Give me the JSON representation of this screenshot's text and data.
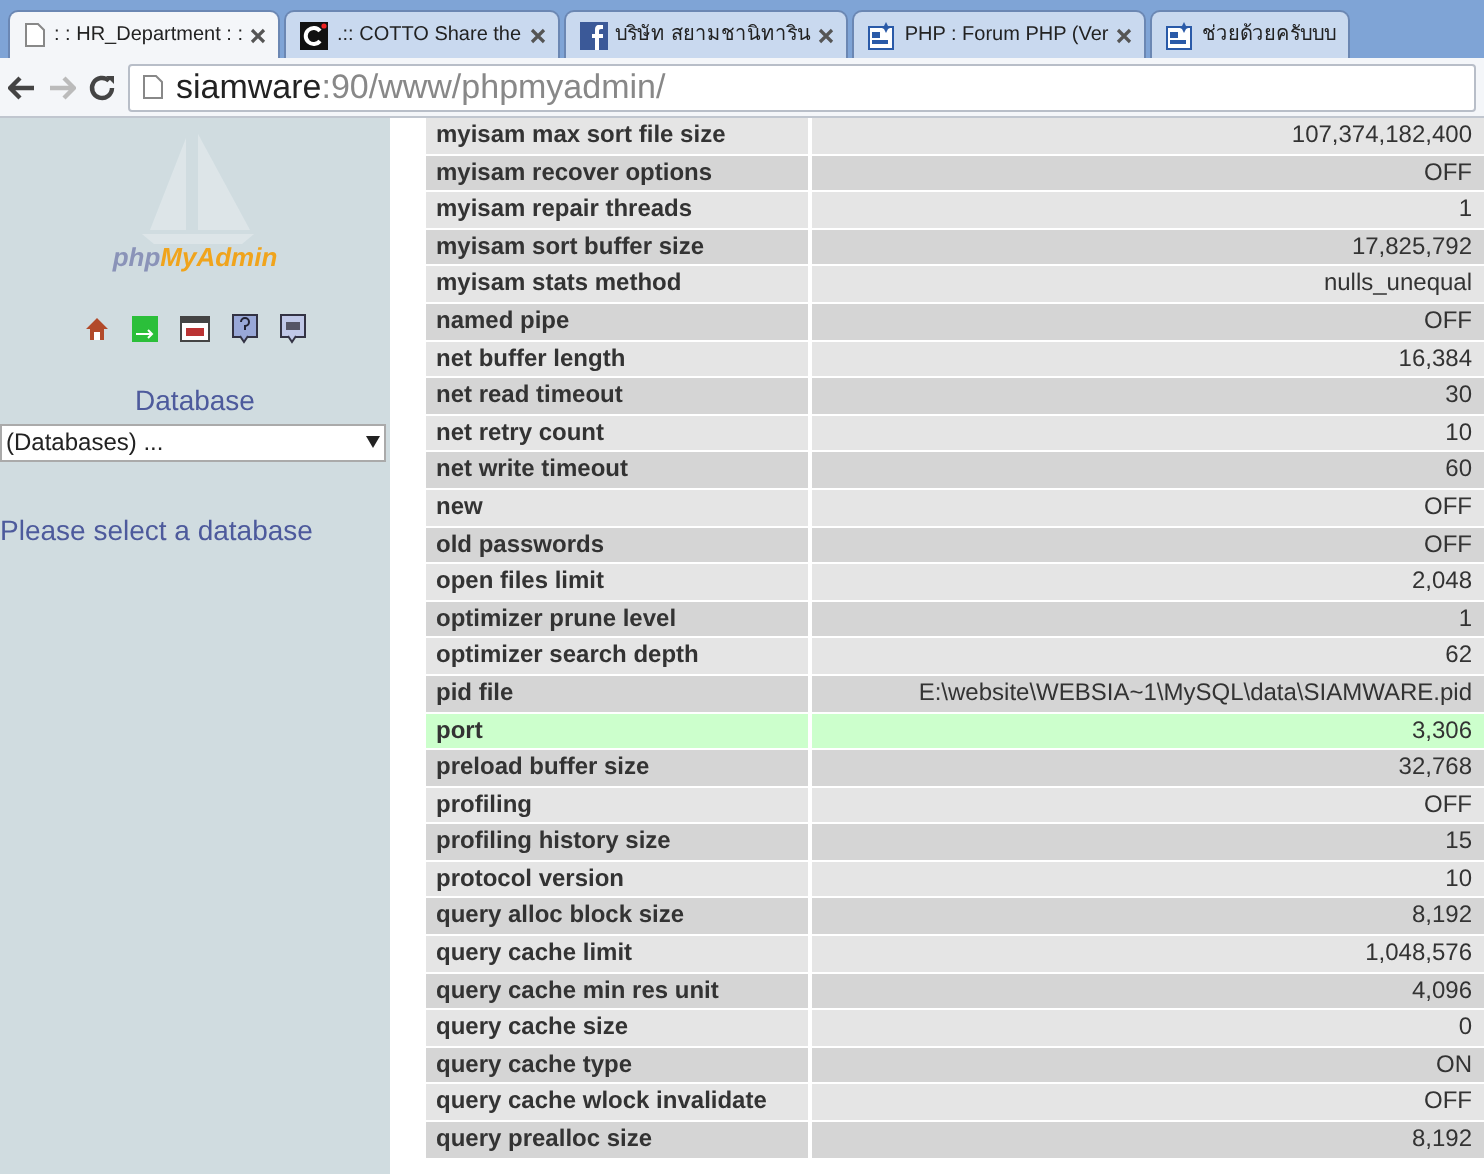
{
  "tabs": [
    {
      "title": ": : HR_Department : :",
      "kind": "page",
      "selected": true
    },
    {
      "title": ".:: COTTO Share the",
      "kind": "c",
      "selected": false
    },
    {
      "title": "บริษัท สยามชานิทาริน",
      "kind": "fb",
      "selected": false
    },
    {
      "title": "PHP : Forum PHP (Ver",
      "kind": "php",
      "selected": false
    },
    {
      "title": "ช่วยด้วยครับบบ",
      "kind": "php",
      "selected": false
    }
  ],
  "address_bar": {
    "host": "siamware",
    "rest": ":90/www/phpmyadmin/"
  },
  "sidebar": {
    "logo": {
      "part_1": "php",
      "part_2": "MyAdmin"
    },
    "database_label": "Database",
    "database_select": "(Databases) ...",
    "message": "Please select a database"
  },
  "table": {
    "rows": [
      {
        "name": "myisam max sort file size",
        "value": "107,374,182,400",
        "highlighted": false
      },
      {
        "name": "myisam recover options",
        "value": "OFF",
        "highlighted": false
      },
      {
        "name": "myisam repair threads",
        "value": "1",
        "highlighted": false
      },
      {
        "name": "myisam sort buffer size",
        "value": "17,825,792",
        "highlighted": false
      },
      {
        "name": "myisam stats method",
        "value": "nulls_unequal",
        "highlighted": false
      },
      {
        "name": "named pipe",
        "value": "OFF",
        "highlighted": false
      },
      {
        "name": "net buffer length",
        "value": "16,384",
        "highlighted": false
      },
      {
        "name": "net read timeout",
        "value": "30",
        "highlighted": false
      },
      {
        "name": "net retry count",
        "value": "10",
        "highlighted": false
      },
      {
        "name": "net write timeout",
        "value": "60",
        "highlighted": false
      },
      {
        "name": "new",
        "value": "OFF",
        "highlighted": false
      },
      {
        "name": "old passwords",
        "value": "OFF",
        "highlighted": false
      },
      {
        "name": "open files limit",
        "value": "2,048",
        "highlighted": false
      },
      {
        "name": "optimizer prune level",
        "value": "1",
        "highlighted": false
      },
      {
        "name": "optimizer search depth",
        "value": "62",
        "highlighted": false
      },
      {
        "name": "pid file",
        "value": "E:\\website\\WEBSIA~1\\MySQL\\data\\SIAMWARE.pid",
        "highlighted": false
      },
      {
        "name": "port",
        "value": "3,306",
        "highlighted": true
      },
      {
        "name": "preload buffer size",
        "value": "32,768",
        "highlighted": false
      },
      {
        "name": "profiling",
        "value": "OFF",
        "highlighted": false
      },
      {
        "name": "profiling history size",
        "value": "15",
        "highlighted": false
      },
      {
        "name": "protocol version",
        "value": "10",
        "highlighted": false
      },
      {
        "name": "query alloc block size",
        "value": "8,192",
        "highlighted": false
      },
      {
        "name": "query cache limit",
        "value": "1,048,576",
        "highlighted": false
      },
      {
        "name": "query cache min res unit",
        "value": "4,096",
        "highlighted": false
      },
      {
        "name": "query cache size",
        "value": "0",
        "highlighted": false
      },
      {
        "name": "query cache type",
        "value": "ON",
        "highlighted": false
      },
      {
        "name": "query cache wlock invalidate",
        "value": "OFF",
        "highlighted": false
      },
      {
        "name": "query prealloc size",
        "value": "8,192",
        "highlighted": false
      }
    ]
  }
}
